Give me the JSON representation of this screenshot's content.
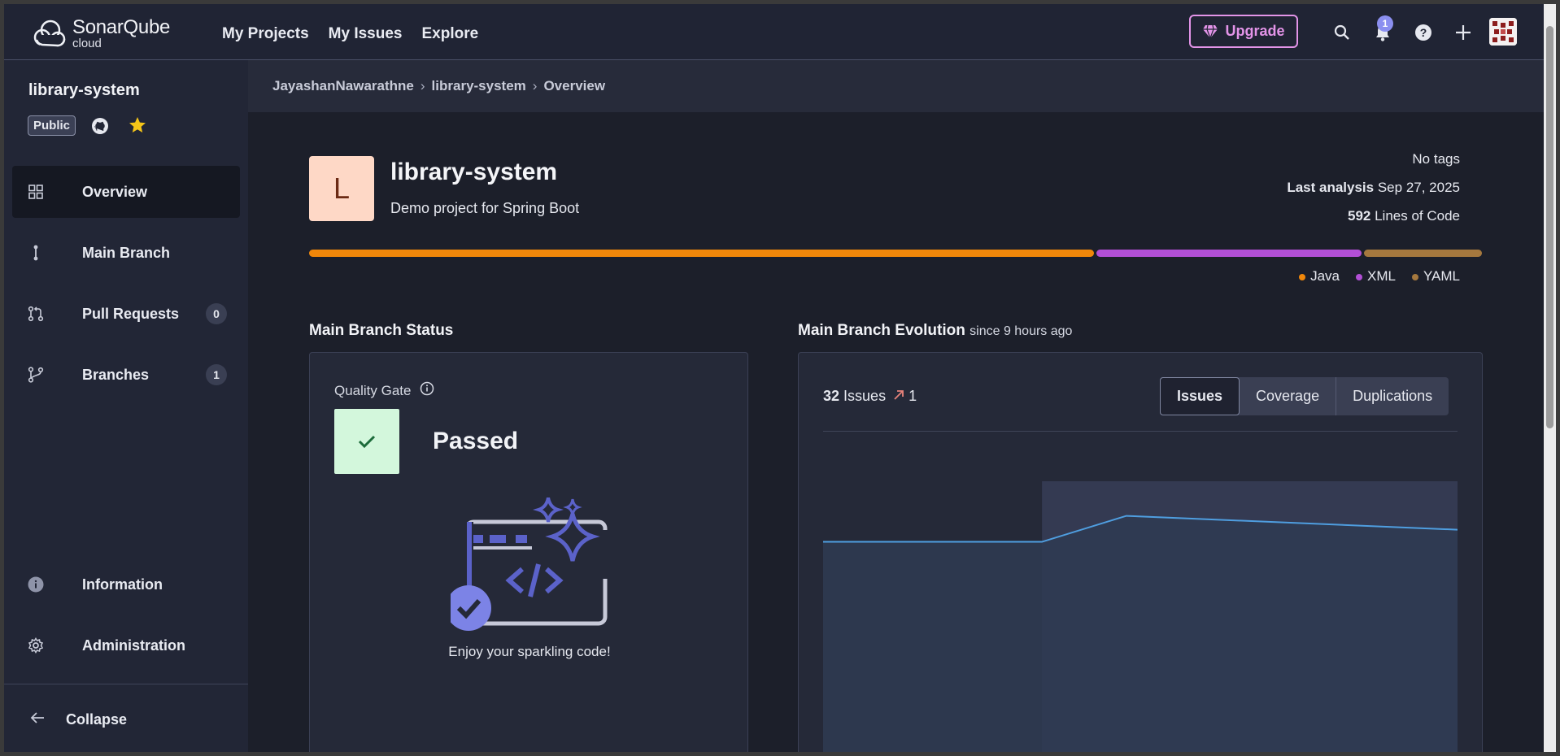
{
  "topbar": {
    "logo_line1": "SonarQube",
    "logo_line2": "cloud",
    "nav": [
      "My Projects",
      "My Issues",
      "Explore"
    ],
    "upgrade_label": "Upgrade",
    "notification_count": "1",
    "icons": [
      "search-icon",
      "bell-icon",
      "help-icon",
      "plus-icon",
      "avatar"
    ],
    "accent": "#e394e8"
  },
  "sidebar": {
    "project_name": "library-system",
    "visibility": "Public",
    "items": [
      {
        "label": "Overview",
        "icon": "dashboard-icon",
        "active": true
      },
      {
        "label": "Main Branch",
        "icon": "branch-icon"
      },
      {
        "label": "Pull Requests",
        "icon": "pull-request-icon",
        "count": "0"
      },
      {
        "label": "Branches",
        "icon": "branches-icon",
        "count": "1"
      },
      {
        "label": "Information",
        "icon": "info-icon"
      },
      {
        "label": "Administration",
        "icon": "gear-icon"
      }
    ],
    "collapse_label": "Collapse"
  },
  "breadcrumb": [
    "JayashanNawarathne",
    "library-system",
    "Overview"
  ],
  "project": {
    "initial": "L",
    "title": "library-system",
    "description": "Demo project for Spring Boot",
    "tags": "No tags",
    "last_analysis_label": "Last analysis",
    "last_analysis_date": "Sep 27, 2025",
    "loc_value": "592",
    "loc_label": "Lines of Code"
  },
  "languages": [
    {
      "name": "Java",
      "color": "#f0870a",
      "share": 0.672
    },
    {
      "name": "XML",
      "color": "#b24fd6",
      "share": 0.227
    },
    {
      "name": "YAML",
      "color": "#a5783e",
      "share": 0.101
    }
  ],
  "status": {
    "title": "Main Branch Status",
    "quality_gate_label": "Quality Gate",
    "result": "Passed",
    "message": "Enjoy your sparkling code!",
    "result_color": "#d3f7dc"
  },
  "evolution": {
    "title": "Main Branch Evolution",
    "since": "since 9 hours ago",
    "issues_count": "32",
    "issues_label": "Issues",
    "issues_delta": "1",
    "tabs": [
      "Issues",
      "Coverage",
      "Duplications"
    ],
    "active_tab": "Issues"
  },
  "chart_data": {
    "type": "area",
    "series": [
      {
        "values": [
          33.5,
          33.5,
          35,
          34.2
        ]
      }
    ],
    "highlight_start_index": 1,
    "line_color": "#4f9ee0",
    "fill_color": "#2f3b52"
  }
}
